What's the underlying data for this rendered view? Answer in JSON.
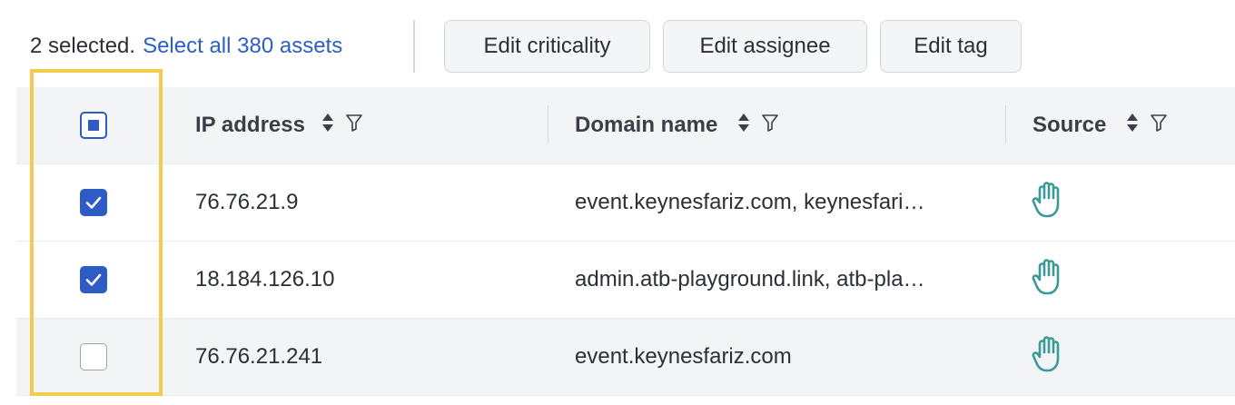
{
  "toolbar": {
    "selected_text": "2 selected.",
    "select_all_link": "Select all 380 assets",
    "buttons": [
      "Edit criticality",
      "Edit assignee",
      "Edit tag"
    ]
  },
  "table": {
    "columns": [
      "IP address",
      "Domain name",
      "Source"
    ],
    "header_checkbox_state": "indeterminate",
    "rows": [
      {
        "checked": true,
        "ip": "76.76.21.9",
        "domain": "event.keynesfariz.com, keynesfari…",
        "source_icon": "hand-icon"
      },
      {
        "checked": true,
        "ip": "18.184.126.10",
        "domain": "admin.atb-playground.link, atb-pla…",
        "source_icon": "hand-icon"
      },
      {
        "checked": false,
        "ip": "76.76.21.241",
        "domain": "event.keynesfariz.com",
        "source_icon": "hand-icon"
      }
    ]
  },
  "colors": {
    "accent": "#2f5bc4",
    "link": "#2a5fc4",
    "highlight_box": "#f3cc4f",
    "source_icon": "#3a9a97"
  }
}
